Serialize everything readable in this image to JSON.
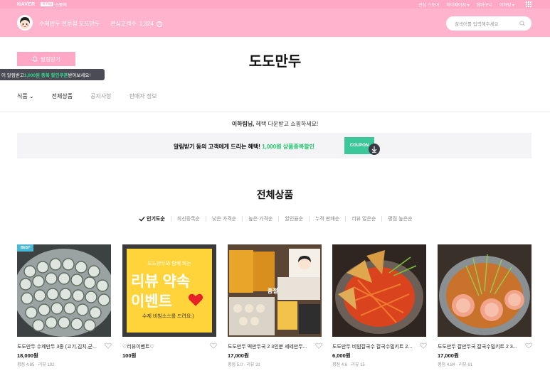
{
  "topbar": {
    "naver": "NAVER",
    "store_mark_np": "N Pay",
    "store_mark": "스토어",
    "links": [
      "관심 스토어",
      "마이페이지 ▾",
      "장바구니",
      "이하림 ▾"
    ]
  },
  "store": {
    "name": "수제만두 전문점 도도만두",
    "interest_label": "관심고객수",
    "interest_count": "1,324",
    "search_placeholder": "검색어를 입력해주세요"
  },
  "title": "도도만두",
  "notify": {
    "button_label": "알림받기",
    "tooltip_prefix": "어 알림받고 ",
    "tooltip_highlight": "1,000원 중복 할인쿠폰",
    "tooltip_suffix": " 받아보세요!"
  },
  "nav": {
    "items": [
      "식품 ⌄",
      "전체상품",
      "공지사항",
      "판매자 정보"
    ]
  },
  "coupon": {
    "greet_name": "이하림님,",
    "greet_rest": " 혜택 다운받고 쇼핑하세요!",
    "banner_prefix": "알림받기 동의 고객에게 드리는 혜택! ",
    "banner_highlight": "1,000원 상품중복할인",
    "tag": "COUPON"
  },
  "products_section": {
    "title": "전체상품",
    "sorts": [
      "인기도순",
      "최신등록순",
      "낮은 가격순",
      "높은 가격순",
      "할인율순",
      "누적 판매순",
      "리뷰 많은순",
      "평점 높은순"
    ]
  },
  "products": [
    {
      "name": "도도만두 수제만두 3종 (고기,김치,군...",
      "price": "18,000원",
      "rating": "평점 4.85 · 리뷰 192",
      "badge": "BEST"
    },
    {
      "name": "♡리뷰이벤트♡",
      "price": "100원",
      "rating": "",
      "thumb_line1": "도도만두와 함께 하는",
      "thumb_line2": "리뷰 약속",
      "thumb_line3": "이벤트",
      "thumb_line4": "수제 비빔소스를 드려요:)"
    },
    {
      "name": "도도만두 떡만두국 2 3인분 세테만두...",
      "price": "17,000원",
      "rating": "평점 5.0 · 리뷰 31",
      "thumb_label": "품절"
    },
    {
      "name": "도도만두 비빔칼국수 칼국수밀키트 2...",
      "price": "6,000원",
      "rating": "평점 4.6 · 리뷰 15"
    },
    {
      "name": "도도만두 칼만두국 칼국수밀키트 2 3...",
      "price": "17,000원",
      "rating": "평점 4.84 · 리뷰 61"
    }
  ],
  "colors": {
    "brand_pink": "#ffb3cc",
    "topbar_pink": "#ffa8c5",
    "coupon_green": "#22c46c",
    "best_badge": "#4bb8d6"
  }
}
